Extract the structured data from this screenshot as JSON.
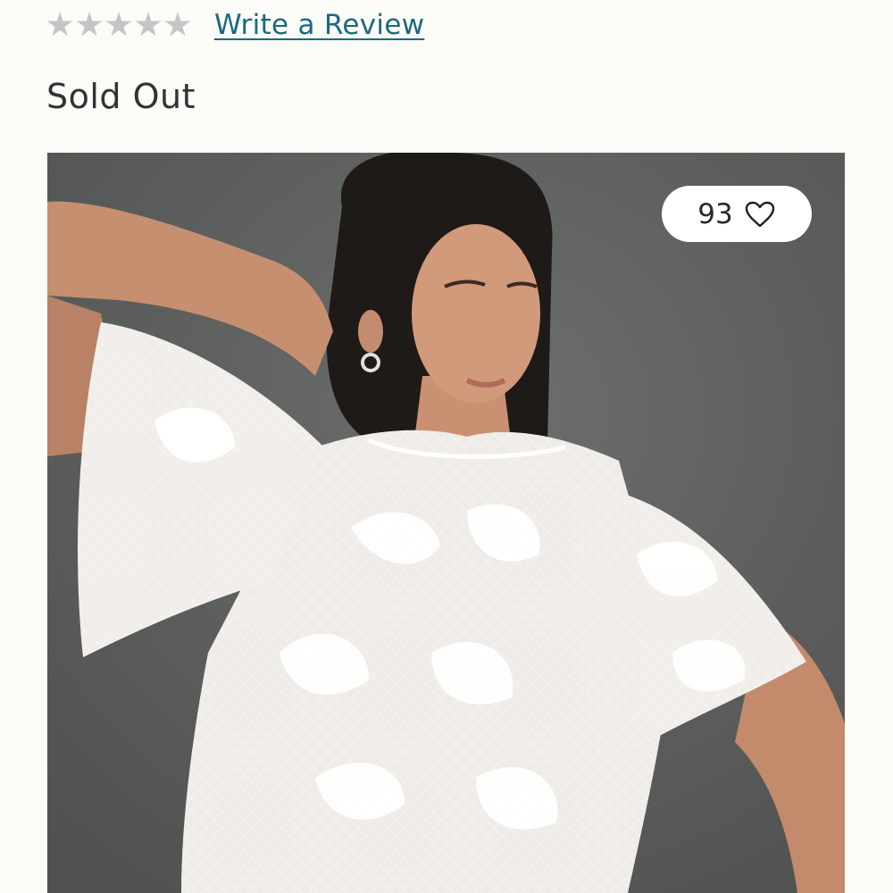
{
  "rating": {
    "stars": 5,
    "filled": 0,
    "star_color": "#c5c5c5",
    "review_link_label": "Write a Review",
    "link_color": "#1b6a7d"
  },
  "availability": {
    "status_label": "Sold Out"
  },
  "product_image": {
    "alt": "Model wearing a white lace flutter-sleeve top"
  },
  "favorites": {
    "count": "93",
    "icon": "heart-outline-icon"
  }
}
